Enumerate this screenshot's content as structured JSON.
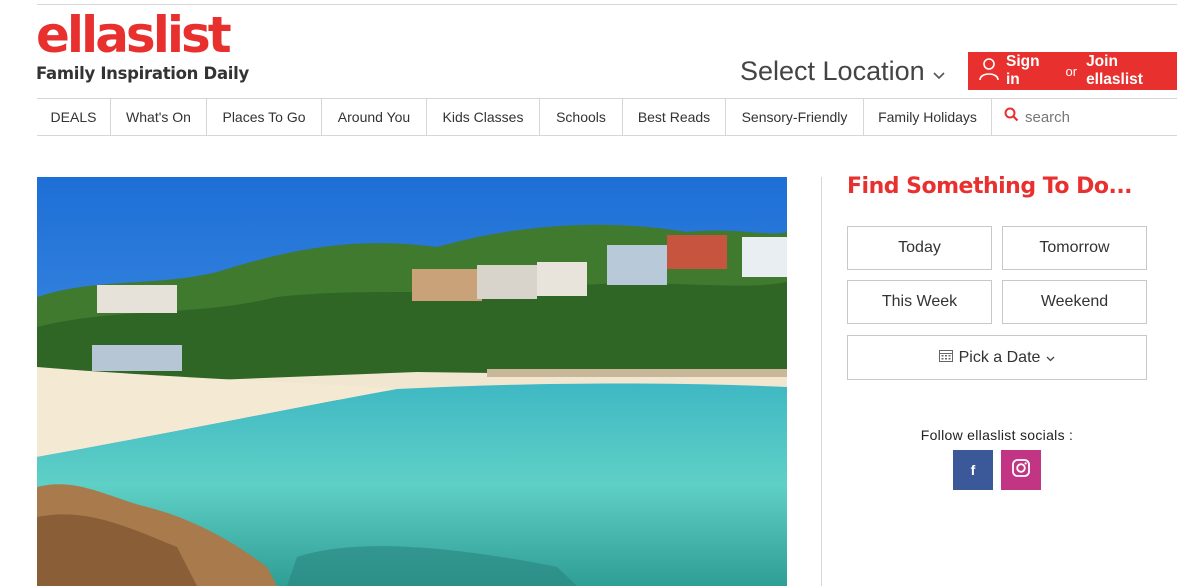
{
  "brand": {
    "logo_text": "ellaslist",
    "tagline": "Family Inspiration Daily",
    "accent_color": "#e8312f"
  },
  "header": {
    "location_label": "Select Location",
    "signin": {
      "sign_in": "Sign in",
      "or": "or",
      "join": "Join ellaslist"
    }
  },
  "nav": {
    "items": [
      "DEALS",
      "What's On",
      "Places To Go",
      "Around You",
      "Kids Classes",
      "Schools",
      "Best Reads",
      "Sensory-Friendly",
      "Family Holidays"
    ],
    "search_placeholder": "search"
  },
  "hero": {
    "image": "beach-cove-photo"
  },
  "sidebar": {
    "title": "Find Something To Do...",
    "buttons": {
      "today": "Today",
      "tomorrow": "Tomorrow",
      "this_week": "This Week",
      "weekend": "Weekend"
    },
    "pick_date": "Pick a Date",
    "follow_label": "Follow ellaslist socials :",
    "socials": [
      {
        "name": "facebook-icon",
        "glyph": "f",
        "color": "#3b5998"
      },
      {
        "name": "instagram-icon",
        "color": "#c13584"
      }
    ]
  }
}
